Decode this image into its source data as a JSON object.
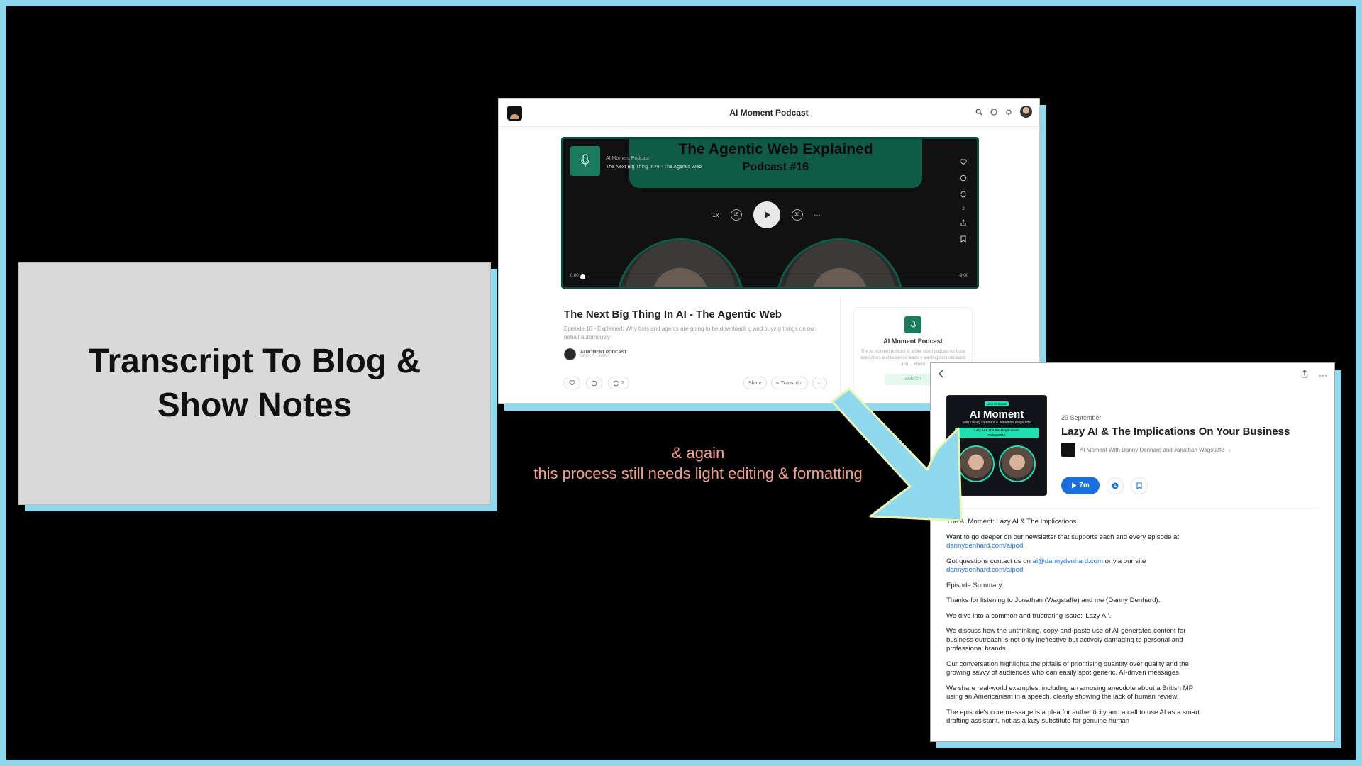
{
  "slide": {
    "heading": "Transcript To Blog & Show Notes",
    "caption_line1": "& again",
    "caption_line2": "this process still needs light editing & formatting"
  },
  "podcast_page": {
    "app_title": "AI Moment Podcast",
    "header_icons": [
      "search-icon",
      "chat-icon",
      "bell-icon",
      "avatar"
    ],
    "player": {
      "banner_line1": "The Agentic Web Explained",
      "banner_line2": "Podcast #16",
      "show_name": "AI Moment Podcast",
      "episode_name": "The Next Big Thing In AI - The Agentic Web",
      "speed": "1x",
      "skip_back": "15",
      "skip_fwd": "30",
      "restack_count": "2",
      "time_start": "0:00",
      "time_end": "-9:00"
    },
    "episode": {
      "title": "The Next Big Thing In AI - The Agentic Web",
      "description": "Episode 16 - Explained: Why bots and agents are going to be downloading and buying things on our behalf automously",
      "author": "AI MOMENT PODCAST",
      "date": "SEP 22, 2025",
      "restack_count": "2",
      "share_label": "Share",
      "transcript_label": "Transcript"
    },
    "about": {
      "name": "AI Moment Podcast",
      "description": "The AI Moment podcast is a bite sized podcast for busy executives and business leaders wanting to understand and ... World",
      "subscribe_label": "Subscri"
    }
  },
  "episode_page": {
    "date": "29 September",
    "title": "Lazy AI & The Implications On Your Business",
    "show": "AI Moment With Danny Denhard and Jonathan Wagstaffe",
    "play_label": "7m",
    "cover": {
      "tag": "NEW EPISODE",
      "brand": "AI Moment",
      "hosts": "with Danny Denhard & Jonathan Wagstaffe",
      "bar_line1": "Lazy AI & The Real Implications",
      "bar_line2": "Podcast #18"
    },
    "notes": {
      "p1": "The AI Moment: Lazy AI & The Implications",
      "p2_text": "Want to go deeper on our newsletter that supports each and every episode at ",
      "p2_link": "dannydenhard.com/aipod",
      "p3_text": "Got questions contact us on ",
      "p3_link1": "ai@dannydenhard.com",
      "p3_mid": " or via our site ",
      "p3_link2": "dannydenhard.com/aipod",
      "p4": "Episode Summary:",
      "p5": "Thanks for listening to Jonathan (Wagstaffe) and me (Danny Denhard).",
      "p6": "We dive into a common and frustrating issue: 'Lazy AI'.",
      "p7": "We discuss how the unthinking, copy-and-paste use of AI-generated content for business outreach is not only ineffective but actively damaging to personal and professional brands.",
      "p8": "Our conversation highlights the pitfalls of prioritising quantity over quality and the growing savvy of audiences who can easily spot generic, AI-driven messages.",
      "p9": "We share real-world examples, including an amusing anecdote about a British MP using an Americanism in a speech, clearly showing the lack of human review.",
      "p10": "The episode's core message is a plea for authenticity and a call to use AI as a smart drafting assistant, not as a lazy substitute for genuine human"
    }
  },
  "colors": {
    "frame": "#8fd9ef",
    "caption": "#f2a08c",
    "accent_green": "#0f5b46",
    "link_blue": "#1a6fe0"
  }
}
